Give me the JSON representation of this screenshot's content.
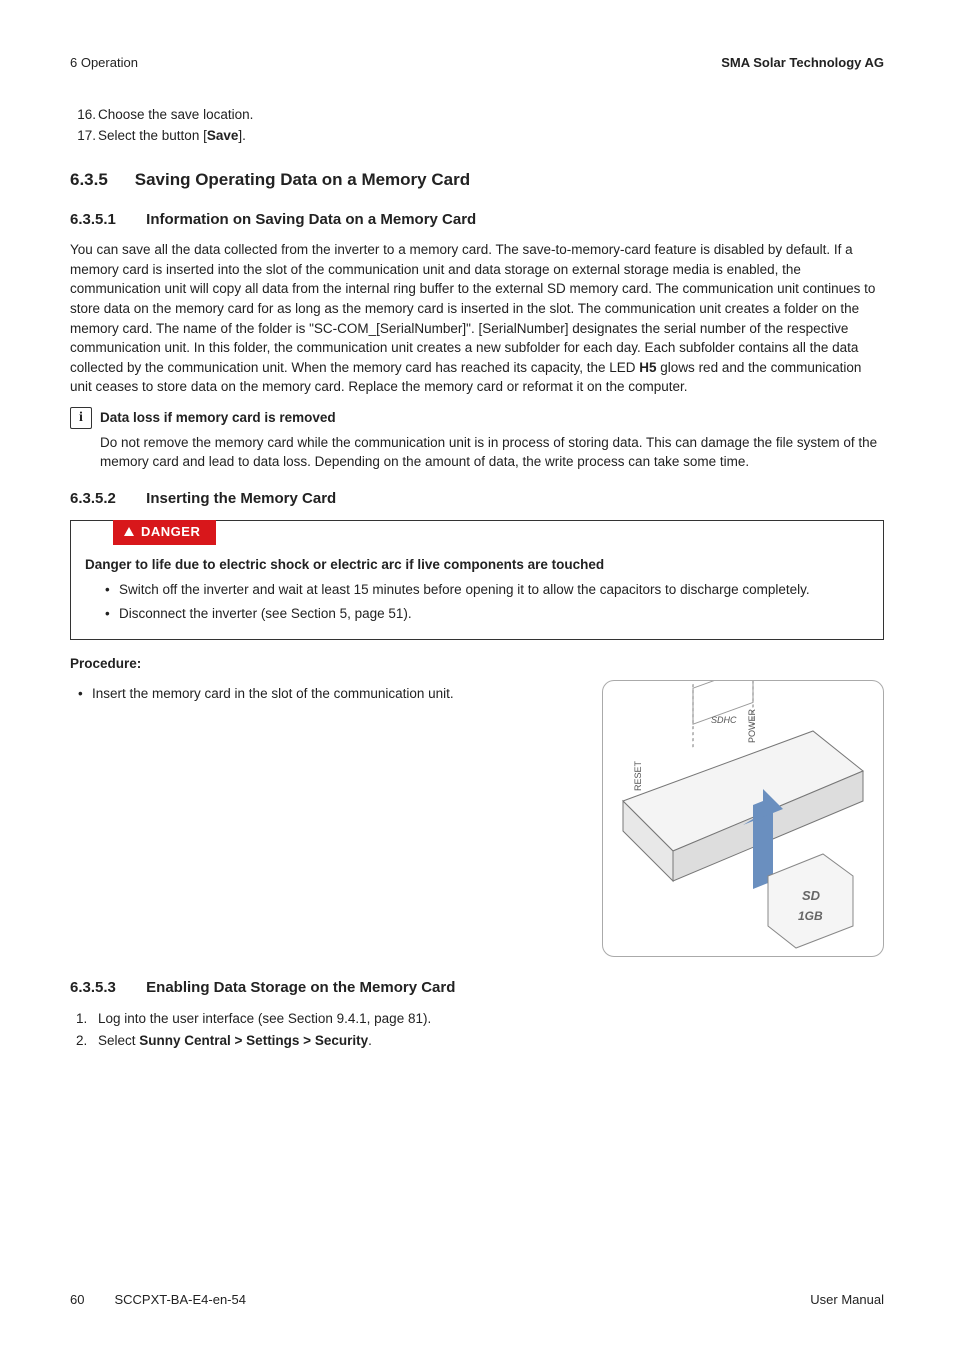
{
  "header": {
    "left": "6 Operation",
    "right": "SMA Solar Technology AG"
  },
  "steps_cont": [
    {
      "num": "16.",
      "text": "Choose the save location."
    },
    {
      "num": "17.",
      "text_pre": "Select the button [",
      "bold": "Save",
      "text_post": "]."
    }
  ],
  "sec635": {
    "num": "6.3.5",
    "title": "Saving Operating Data on a Memory Card"
  },
  "sec6351": {
    "num": "6.3.5.1",
    "title": "Information on Saving Data on a Memory Card",
    "para_pre": "You can save all the data collected from the inverter to a memory card. The save-to-memory-card feature is disabled by default. If a memory card is inserted into the slot of the communication unit and data storage on external storage media is enabled, the communication unit will copy all data from the internal ring buffer to the external SD memory card. The communication unit continues to store data on the memory card for as long as the memory card is inserted in the slot. The communication unit creates a folder on the memory card. The name of the folder is \"SC-COM_[SerialNumber]\". [SerialNumber] designates the serial number of the respective communication unit. In this folder, the communication unit creates a new subfolder for each day. Each subfolder contains all the data collected by the communication unit. When the memory card has reached its capacity, the LED ",
    "para_bold": "H5",
    "para_post": " glows red and the communication unit ceases to store data on the memory card. Replace the memory card or reformat it on the computer."
  },
  "info": {
    "icon_char": "i",
    "title": "Data loss if memory card is removed",
    "body": "Do not remove the memory card while the communication unit is in process of storing data. This can damage the file system of the memory card and lead to data loss. Depending on the amount of data, the write process can take some time."
  },
  "sec6352": {
    "num": "6.3.5.2",
    "title": "Inserting the Memory Card"
  },
  "danger": {
    "label": "DANGER",
    "title": "Danger to life due to electric shock or electric arc if live components are touched",
    "items": [
      "Switch off the inverter and wait at least 15 minutes before opening it to allow the capacitors to discharge completely.",
      "Disconnect the inverter (see Section 5, page 51)."
    ]
  },
  "procedure": {
    "heading": "Procedure:",
    "item": "Insert the memory card in the slot of the communication unit."
  },
  "figure_labels": {
    "reset": "RESET",
    "sdhc": "SDHC",
    "power": "POWER",
    "sd": "SD",
    "gb": "1GB"
  },
  "sec6353": {
    "num": "6.3.5.3",
    "title": "Enabling Data Storage on the Memory Card",
    "steps": [
      {
        "n": "1.",
        "text": "Log into the user interface (see Section 9.4.1, page 81)."
      },
      {
        "n": "2.",
        "text_pre": "Select ",
        "bold": "Sunny Central > Settings > Security",
        "text_post": "."
      }
    ]
  },
  "footer": {
    "page": "60",
    "doc": "SCCPXT-BA-E4-en-54",
    "manual": "User Manual"
  }
}
